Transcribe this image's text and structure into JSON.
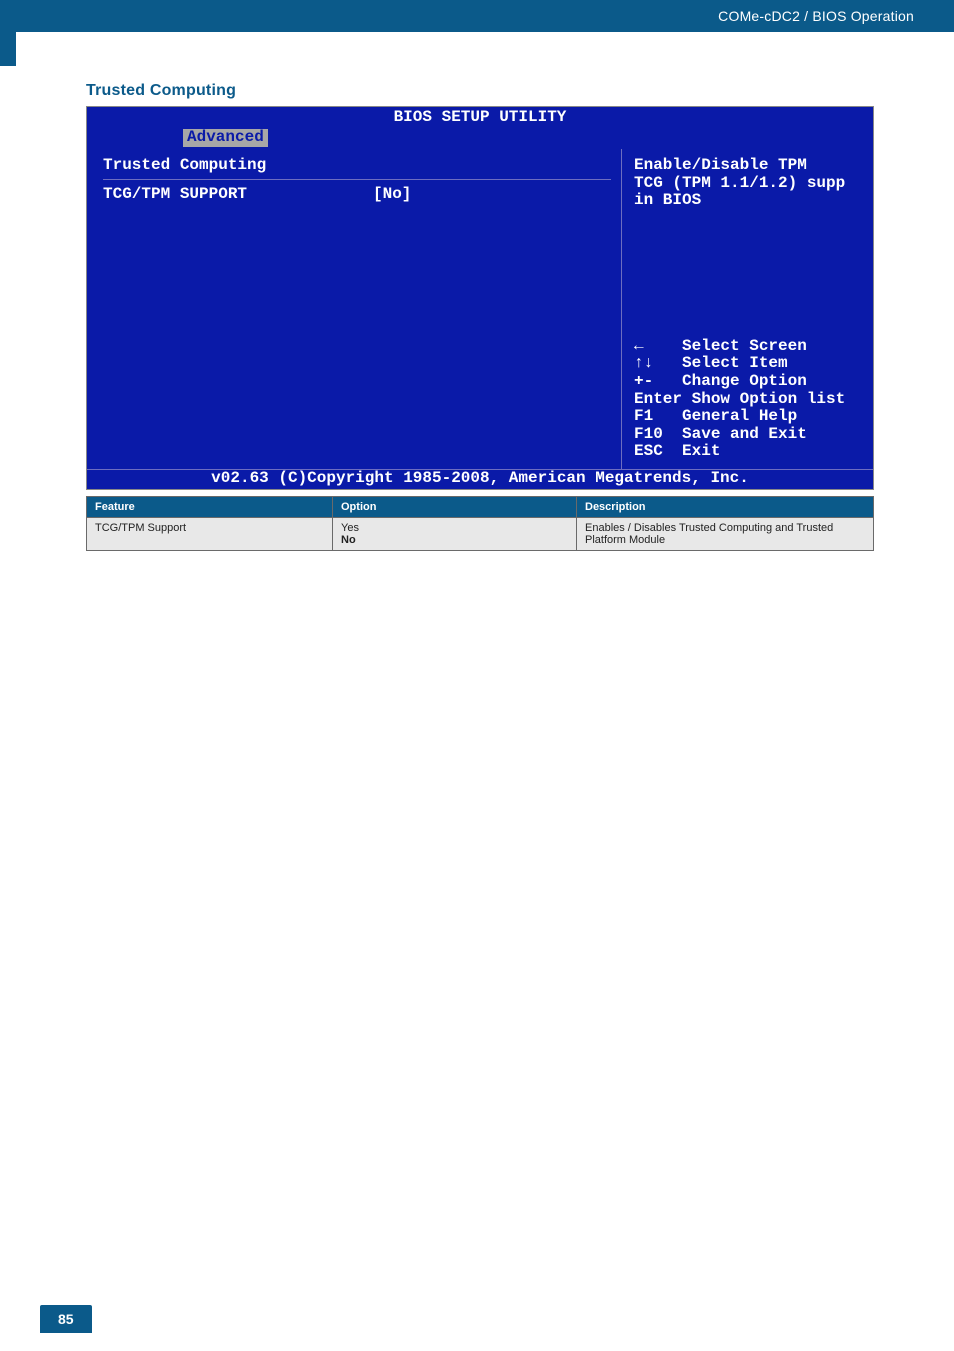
{
  "header": {
    "breadcrumb": "COMe-cDC2 / BIOS Operation"
  },
  "section": {
    "title": "Trusted Computing"
  },
  "bios": {
    "title": "BIOS SETUP UTILITY",
    "tab": "Advanced",
    "left": {
      "heading": "Trusted Computing",
      "item_label": "TCG/TPM SUPPORT",
      "item_value": "[No]"
    },
    "right": {
      "desc1": "Enable/Disable TPM",
      "desc2": "TCG (TPM 1.1/1.2) supp",
      "desc3": "in BIOS",
      "kh1": "←    Select Screen",
      "kh2": "↑↓   Select Item",
      "kh3": "+-   Change Option",
      "kh4": "Enter Show Option list",
      "kh5": "F1   General Help",
      "kh6": "F10  Save and Exit",
      "kh7": "ESC  Exit"
    },
    "footer": "v02.63 (C)Copyright 1985-2008, American Megatrends, Inc."
  },
  "table": {
    "headers": {
      "feature": "Feature",
      "option": "Option",
      "description": "Description"
    },
    "rows": [
      {
        "feature": "TCG/TPM Support",
        "option_line1": "Yes",
        "option_line2": "No",
        "description": "Enables / Disables Trusted Computing and Trusted Platform Module"
      }
    ]
  },
  "page_number": "85"
}
